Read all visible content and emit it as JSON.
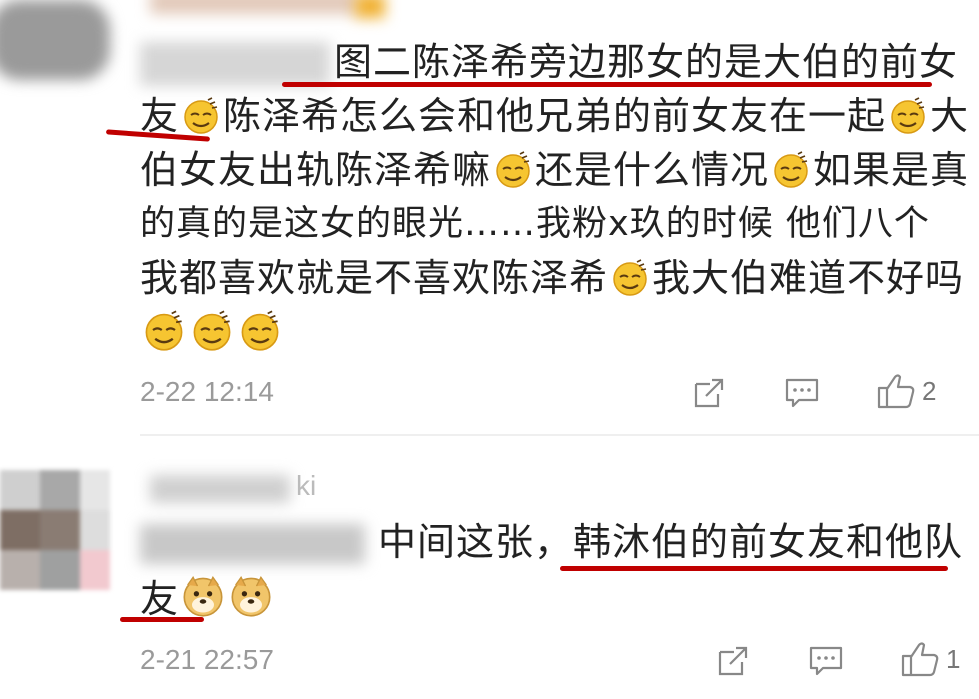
{
  "comments": [
    {
      "text_line1": "图二陈泽希旁边那女的是大伯的前女",
      "text_line2_a": "友",
      "text_line2_b": "陈泽希怎么会和他兄弟的前女友在一起",
      "text_line2_c": "大",
      "text_line3_a": "伯女友出轨陈泽希嘛",
      "text_line3_b": "还是什么情况",
      "text_line3_c": "如果是真",
      "text_line4": "的真的是这女的眼光……我粉x玖的时候 他们八个",
      "text_line5_a": "我都喜欢就是不喜欢陈泽希",
      "text_line5_b": "我大伯难道不好吗",
      "timestamp": "2-22 12:14",
      "like_count": "2",
      "emoji": "sweat-smile-emoji"
    },
    {
      "username": "ki",
      "text_line1": "中间这张，韩沐伯的前女友和他队",
      "text_line2": "友",
      "timestamp": "2-21 22:57",
      "like_count": "1",
      "emoji": "doge-emoji"
    }
  ],
  "colors": {
    "underline": "#c00000",
    "meta_text": "#9a9a9a",
    "body_text": "#222222"
  }
}
